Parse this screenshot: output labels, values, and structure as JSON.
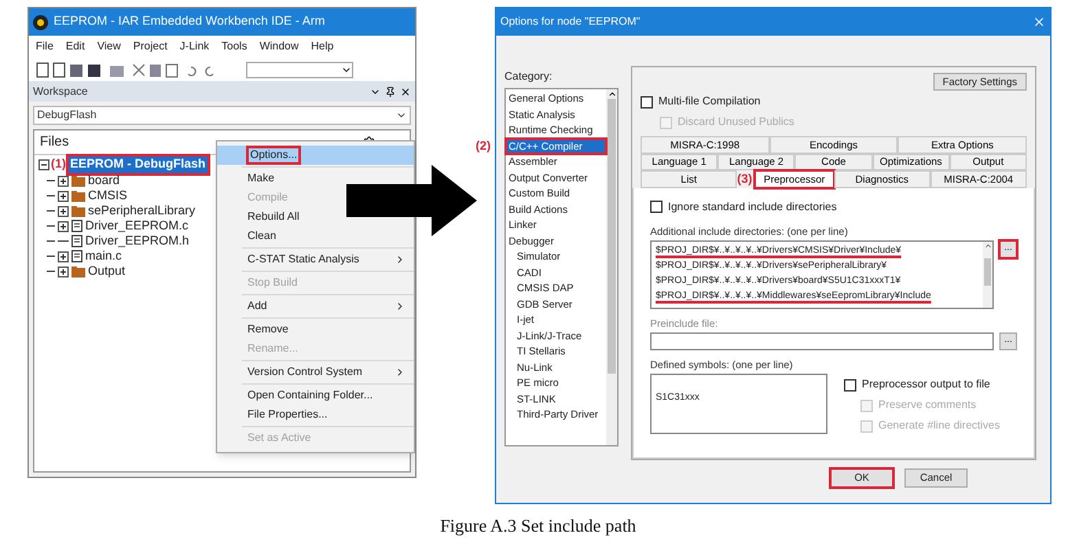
{
  "ide": {
    "title": "EEPROM - IAR Embedded Workbench IDE - Arm",
    "menu": [
      "File",
      "Edit",
      "View",
      "Project",
      "J-Link",
      "Tools",
      "Window",
      "Help"
    ],
    "workspace_label": "Workspace",
    "configuration": "DebugFlash",
    "files_label": "Files",
    "tree": {
      "label": "EEPROM - DebugFlash",
      "annotation": "(1)",
      "highlighted": true,
      "selected": true,
      "children": [
        {
          "label": "board",
          "kind": "folder",
          "expandable": true
        },
        {
          "label": "CMSIS",
          "kind": "folder",
          "expandable": true
        },
        {
          "label": "sePeripheralLibrary",
          "kind": "folder",
          "expandable": true
        },
        {
          "label": "Driver_EEPROM.c",
          "kind": "file",
          "expandable": true
        },
        {
          "label": "Driver_EEPROM.h",
          "kind": "file",
          "expandable": false
        },
        {
          "label": "main.c",
          "kind": "file",
          "expandable": true
        },
        {
          "label": "Output",
          "kind": "folder",
          "expandable": true
        }
      ]
    },
    "context_menu": [
      [
        {
          "label": "Options...",
          "selected": true,
          "highlighted": true,
          "disabled": false,
          "submenu": false
        }
      ],
      [
        {
          "label": "Make",
          "selected": false,
          "highlighted": false,
          "disabled": false,
          "submenu": false
        },
        {
          "label": "Compile",
          "selected": false,
          "highlighted": false,
          "disabled": true,
          "submenu": false
        },
        {
          "label": "Rebuild All",
          "selected": false,
          "highlighted": false,
          "disabled": false,
          "submenu": false
        },
        {
          "label": "Clean",
          "selected": false,
          "highlighted": false,
          "disabled": false,
          "submenu": false
        }
      ],
      [
        {
          "label": "C-STAT Static Analysis",
          "selected": false,
          "highlighted": false,
          "disabled": false,
          "submenu": true
        }
      ],
      [
        {
          "label": "Stop Build",
          "selected": false,
          "highlighted": false,
          "disabled": true,
          "submenu": false
        }
      ],
      [
        {
          "label": "Add",
          "selected": false,
          "highlighted": false,
          "disabled": false,
          "submenu": true
        }
      ],
      [
        {
          "label": "Remove",
          "selected": false,
          "highlighted": false,
          "disabled": false,
          "submenu": false
        },
        {
          "label": "Rename...",
          "selected": false,
          "highlighted": false,
          "disabled": true,
          "submenu": false
        }
      ],
      [
        {
          "label": "Version Control System",
          "selected": false,
          "highlighted": false,
          "disabled": false,
          "submenu": true
        }
      ],
      [
        {
          "label": "Open Containing Folder...",
          "selected": false,
          "highlighted": false,
          "disabled": false,
          "submenu": false
        },
        {
          "label": "File Properties...",
          "selected": false,
          "highlighted": false,
          "disabled": false,
          "submenu": false
        }
      ],
      [
        {
          "label": "Set as Active",
          "selected": false,
          "highlighted": false,
          "disabled": true,
          "submenu": false
        }
      ]
    ]
  },
  "dialog": {
    "title": "Options for node \"EEPROM\"",
    "category_label": "Category:",
    "categories": [
      {
        "label": "General Options",
        "selected": false,
        "highlighted": false
      },
      {
        "label": "Static Analysis",
        "selected": false,
        "highlighted": false
      },
      {
        "label": "Runtime Checking",
        "selected": false,
        "highlighted": false
      },
      {
        "label": "C/C++ Compiler",
        "selected": true,
        "highlighted": true,
        "annotation": "(2)"
      },
      {
        "label": "Assembler",
        "selected": false,
        "highlighted": false
      },
      {
        "label": "Output Converter",
        "selected": false,
        "highlighted": false
      },
      {
        "label": "Custom Build",
        "selected": false,
        "highlighted": false
      },
      {
        "label": "Build Actions",
        "selected": false,
        "highlighted": false
      },
      {
        "label": "Linker",
        "selected": false,
        "highlighted": false
      },
      {
        "label": "Debugger",
        "selected": false,
        "highlighted": false,
        "children": [
          {
            "label": "Simulator",
            "selected": false,
            "highlighted": false
          },
          {
            "label": "CADI",
            "selected": false,
            "highlighted": false
          },
          {
            "label": "CMSIS DAP",
            "selected": false,
            "highlighted": false
          },
          {
            "label": "GDB Server",
            "selected": false,
            "highlighted": false
          },
          {
            "label": "I-jet",
            "selected": false,
            "highlighted": false
          },
          {
            "label": "J-Link/J-Trace",
            "selected": false,
            "highlighted": false
          },
          {
            "label": "TI Stellaris",
            "selected": false,
            "highlighted": false
          },
          {
            "label": "Nu-Link",
            "selected": false,
            "highlighted": false
          },
          {
            "label": "PE micro",
            "selected": false,
            "highlighted": false
          },
          {
            "label": "ST-LINK",
            "selected": false,
            "highlighted": false
          },
          {
            "label": "Third-Party Driver",
            "selected": false,
            "highlighted": false
          }
        ]
      }
    ],
    "factory_settings": "Factory Settings",
    "multifile": {
      "label": "Multi-file Compilation",
      "checked": false,
      "disabled": false
    },
    "discard": {
      "label": "Discard Unused Publics",
      "checked": false,
      "disabled": true
    },
    "tab_rows": [
      [
        {
          "label": "MISRA-C:1998",
          "selected": false
        },
        {
          "label": "Encodings",
          "selected": false
        },
        {
          "label": "Extra Options",
          "selected": false
        }
      ],
      [
        {
          "label": "Language 1",
          "selected": false
        },
        {
          "label": "Language 2",
          "selected": false
        },
        {
          "label": "Code",
          "selected": false
        },
        {
          "label": "Optimizations",
          "selected": false
        },
        {
          "label": "Output",
          "selected": false
        }
      ],
      [
        {
          "label": "List",
          "selected": false
        },
        {
          "label": "Preprocessor",
          "selected": true,
          "highlighted": true,
          "annotation": "(3)"
        },
        {
          "label": "Diagnostics",
          "selected": false
        },
        {
          "label": "MISRA-C:2004",
          "selected": false
        }
      ]
    ],
    "ignore_std": {
      "label": "Ignore standard include directories",
      "checked": false,
      "disabled": false
    },
    "include_label": "Additional include directories: (one per line)",
    "include_lines": [
      {
        "text": "$PROJ_DIR$¥..¥..¥..¥..¥Drivers¥CMSIS¥Driver¥Include¥",
        "underlined": true
      },
      {
        "text": "$PROJ_DIR$¥..¥..¥..¥..¥Drivers¥sePeripheralLibrary¥",
        "underlined": false
      },
      {
        "text": "$PROJ_DIR$¥..¥..¥..¥..¥Drivers¥board¥S5U1C31xxxT1¥",
        "underlined": false
      },
      {
        "text": "$PROJ_DIR$¥..¥..¥..¥..¥Middlewares¥seEepromLibrary¥Include",
        "underlined": true
      }
    ],
    "include_browse": {
      "label": "...",
      "highlighted": true
    },
    "preinclude_label": "Preinclude file:",
    "preinclude_browse": {
      "label": "...",
      "highlighted": false
    },
    "defined_label": "Defined symbols: (one per line)",
    "defined_value": "S1C31xxx",
    "pp_output": {
      "label": "Preprocessor output to file",
      "checked": false,
      "disabled": false
    },
    "preserve": {
      "label": "Preserve comments",
      "checked": false,
      "disabled": true
    },
    "line_directives": {
      "label": "Generate #line directives",
      "checked": false,
      "disabled": true
    },
    "ok": {
      "label": "OK",
      "highlighted": true
    },
    "cancel": {
      "label": "Cancel",
      "highlighted": false
    }
  },
  "caption": "Figure A.3 Set include path"
}
